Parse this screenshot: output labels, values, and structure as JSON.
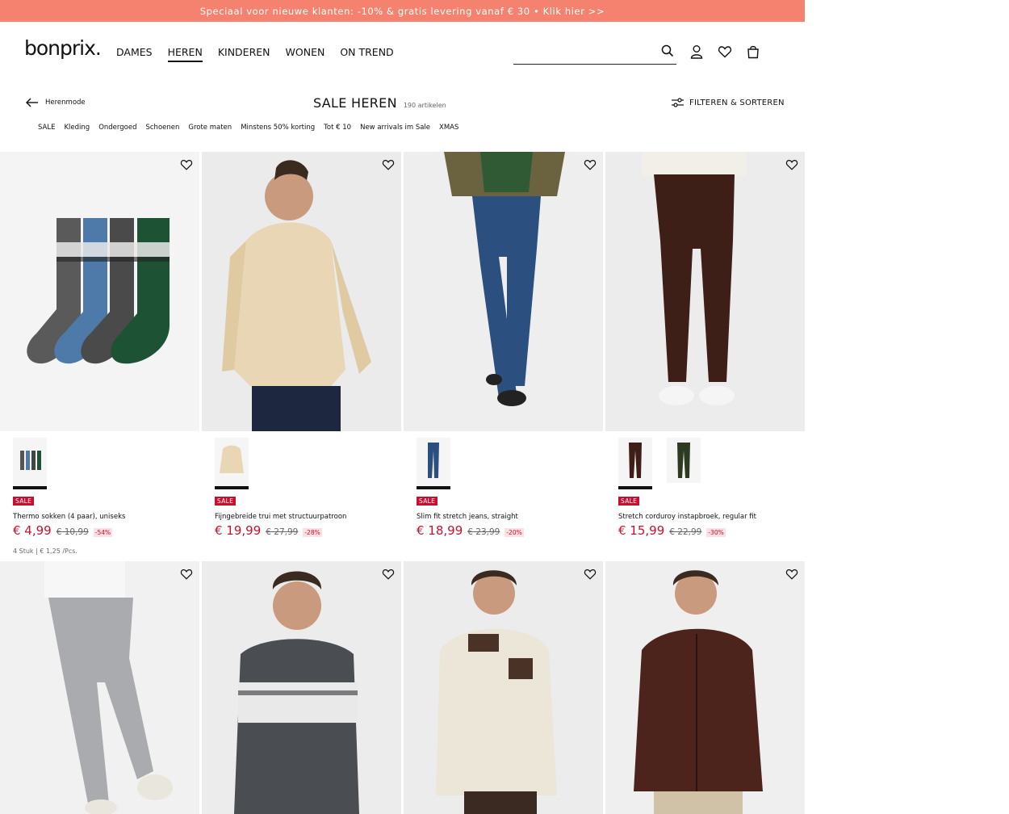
{
  "promo": {
    "text": "Speciaal voor nieuwe klanten: -10% & gratis levering vanaf € 30 • Klik hier >>"
  },
  "header": {
    "logo": "bonprix.",
    "nav": [
      "DAMES",
      "HEREN",
      "KINDEREN",
      "WONEN",
      "ON TREND"
    ],
    "active_nav": "HEREN",
    "search_placeholder": "",
    "icons": [
      "search-icon",
      "account-icon",
      "wishlist-icon",
      "bag-icon"
    ]
  },
  "toolbar": {
    "back_label": "Herenmode",
    "title": "SALE HEREN",
    "count": "190 artikelen",
    "filter_label": "FILTEREN & SORTEREN"
  },
  "categories": [
    "SALE",
    "Kleding",
    "Ondergoed",
    "Schoenen",
    "Grote maten",
    "Minstens 50% korting",
    "Tot € 10",
    "New arrivals im Sale",
    "XMAS"
  ],
  "products": [
    {
      "name": "Thermo sokken (4 paar), uniseks",
      "badge": "SALE",
      "price": "€ 4,99",
      "old_price": "€ 10,99",
      "discount": "-54%",
      "unit": "4 Stuk | € 1,25 /Pcs.",
      "image": "socks"
    },
    {
      "name": "Fijngebreide trui met structuurpatroon",
      "badge": "SALE",
      "price": "€ 19,99",
      "old_price": "€ 27,99",
      "discount": "-28%",
      "unit": "",
      "image": "sweater-beige"
    },
    {
      "name": "Slim fit stretch jeans, straight",
      "badge": "SALE",
      "price": "€ 18,99",
      "old_price": "€ 23,99",
      "discount": "-20%",
      "unit": "",
      "image": "jeans"
    },
    {
      "name": "Stretch corduroy instapbroek, regular fit",
      "badge": "SALE",
      "price": "€ 15,99",
      "old_price": "€ 22,99",
      "discount": "-30%",
      "unit": "",
      "image": "corduroy"
    }
  ],
  "colors": {
    "promo_bg": "#f5826f",
    "sale_red": "#c8102e"
  }
}
